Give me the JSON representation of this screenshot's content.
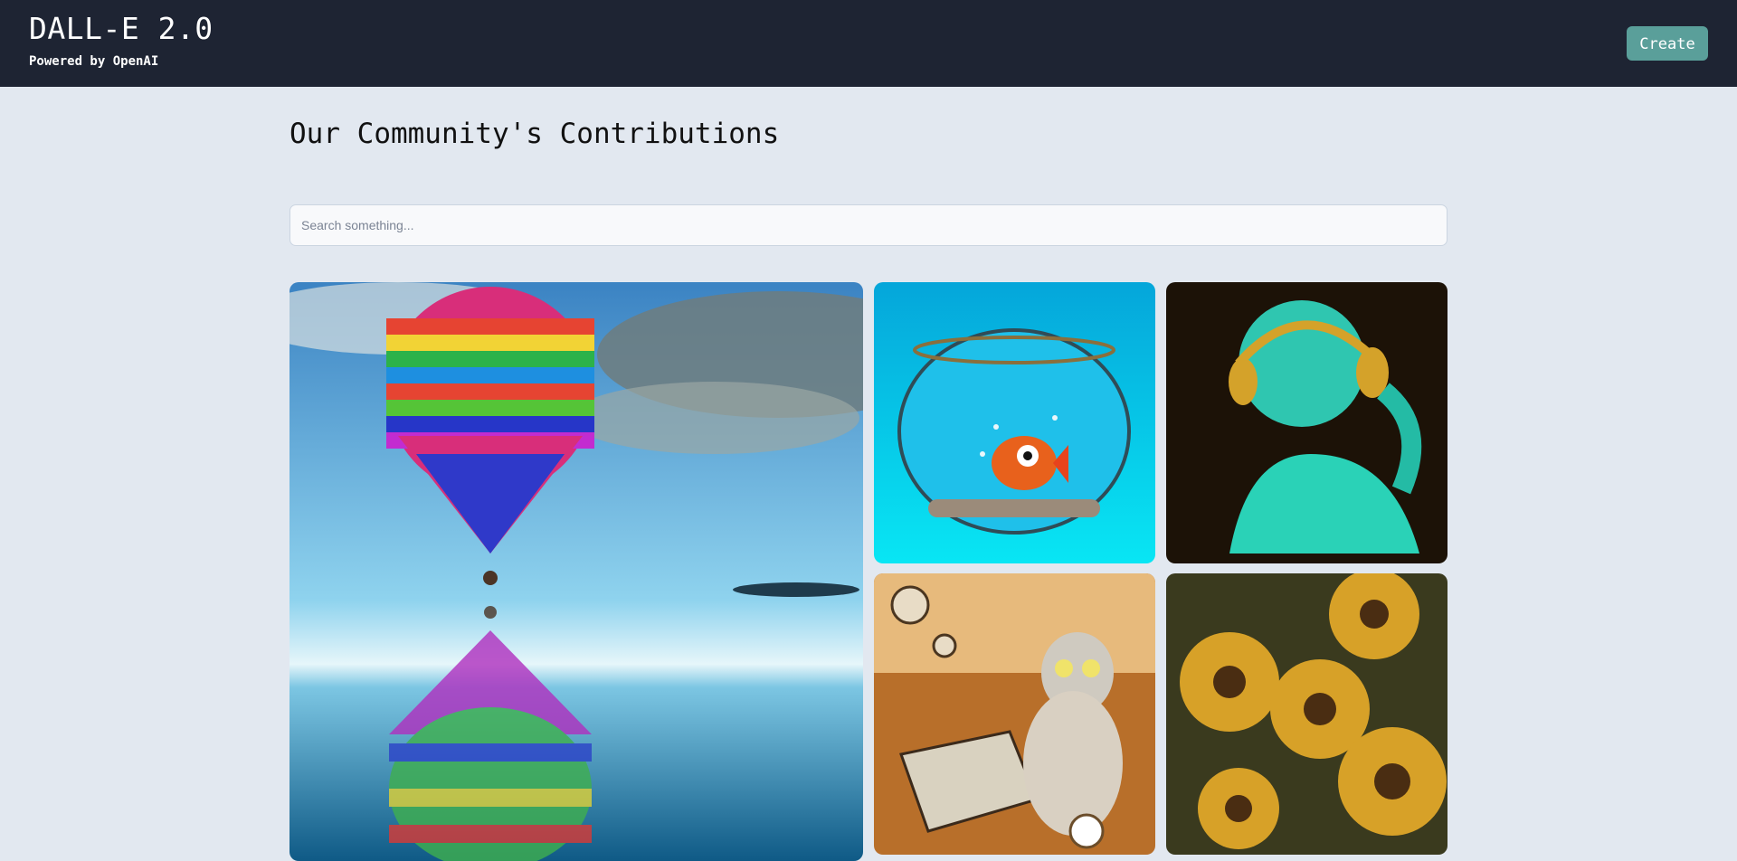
{
  "header": {
    "title": "DALL-E 2.0",
    "subtitle": "Powered by OpenAI",
    "create_label": "Create",
    "bg_color": "#1e2433",
    "accent_color": "#5a9f9a"
  },
  "main": {
    "heading": "Our Community's Contributions",
    "search": {
      "placeholder": "Search something...",
      "value": ""
    },
    "gallery": [
      {
        "name": "balloon-image",
        "icon": "hot-air-balloon-over-water"
      },
      {
        "name": "fishbowl-image",
        "icon": "fish-in-bowl"
      },
      {
        "name": "statue-headphones-image",
        "icon": "statue-with-headphones"
      },
      {
        "name": "cat-chess-image",
        "icon": "cat-playing-chess"
      },
      {
        "name": "sunflowers-image",
        "icon": "sunflower-painting"
      }
    ]
  }
}
